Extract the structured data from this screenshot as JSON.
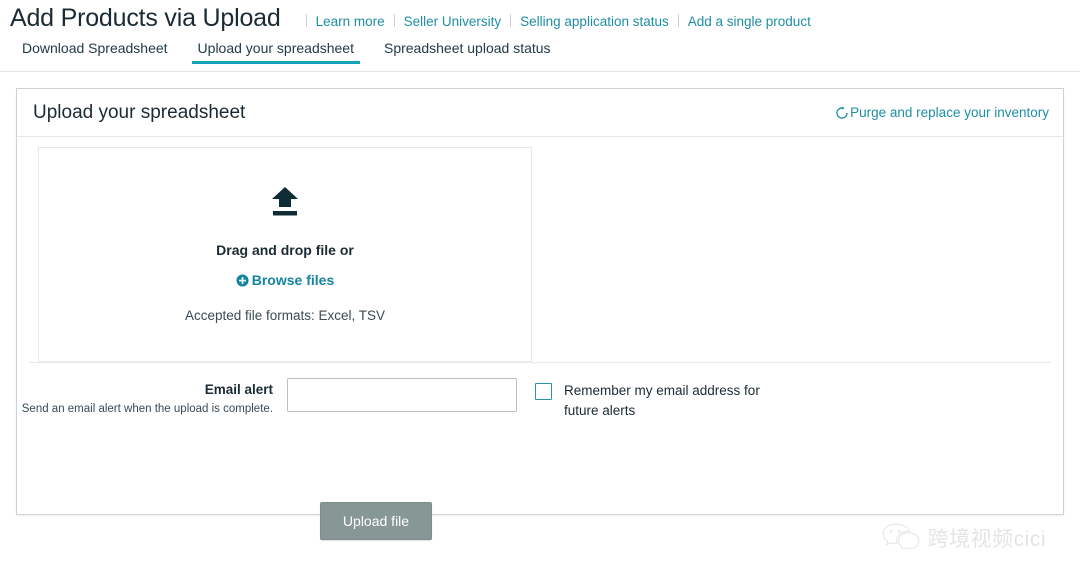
{
  "header": {
    "title": "Add Products via Upload",
    "links": [
      {
        "label": "Learn more"
      },
      {
        "label": "Seller University"
      },
      {
        "label": "Selling application status"
      },
      {
        "label": "Add a single product"
      }
    ]
  },
  "tabs": [
    {
      "label": "Download Spreadsheet",
      "active": false
    },
    {
      "label": "Upload your spreadsheet",
      "active": true
    },
    {
      "label": "Spreadsheet upload status",
      "active": false
    }
  ],
  "card": {
    "title": "Upload your spreadsheet",
    "purge_link": "Purge and replace your inventory",
    "purge_icon": "refresh-icon"
  },
  "dropzone": {
    "upload_icon": "upload-arrow-icon",
    "title": "Drag and drop file or",
    "browse_label": "Browse files",
    "browse_icon": "plus-circle-icon",
    "formats": "Accepted file formats: Excel, TSV"
  },
  "email": {
    "label": "Email alert",
    "help": "Send an email alert when the upload is complete.",
    "value": "",
    "placeholder": "",
    "remember_label": "Remember my email address for future alerts",
    "remember_checked": false
  },
  "actions": {
    "upload_label": "Upload file"
  },
  "watermark": {
    "icon": "wechat-icon",
    "text": "跨境视频cici"
  },
  "colors": {
    "accent_teal": "#1e8fa3",
    "tab_underline": "#14a2b8",
    "dark_text": "#1b2b33",
    "button_gray": "#879795"
  }
}
